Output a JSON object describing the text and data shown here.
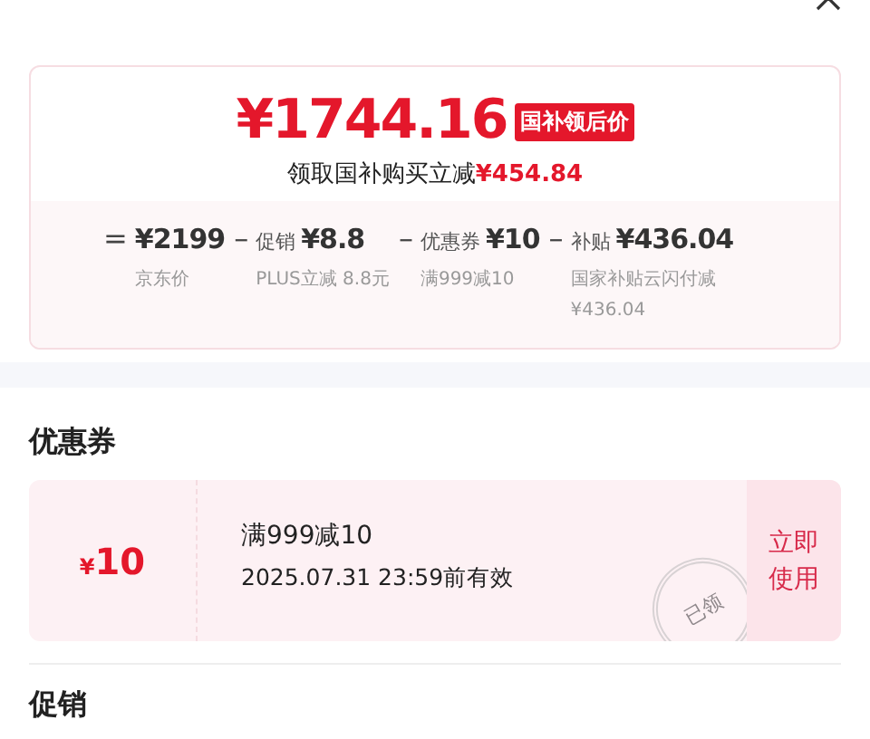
{
  "price_card": {
    "final_price": "¥1744.16",
    "badge": "国补领后价",
    "saving_label": "领取国补购买立减",
    "saving_amount": "¥454.84",
    "breakdown": [
      {
        "op": "=",
        "amount": "¥2199",
        "note": "京东价"
      },
      {
        "op": "–",
        "label": "促销",
        "amount": "¥8.8",
        "note": "PLUS立减 8.8元"
      },
      {
        "op": "–",
        "label": "优惠券",
        "amount": "¥10",
        "note": "满999减10"
      },
      {
        "op": "–",
        "label": "补贴",
        "amount": "¥436.04",
        "note": "国家补贴云闪付减¥436.04"
      }
    ]
  },
  "coupon_section": {
    "title": "优惠券",
    "coupons": [
      {
        "currency": "¥",
        "value": "10",
        "condition": "满999减10",
        "validity": "2025.07.31 23:59前有效",
        "stamp": "已领",
        "action": "立即使用"
      }
    ]
  },
  "promo_section": {
    "title": "促销"
  }
}
